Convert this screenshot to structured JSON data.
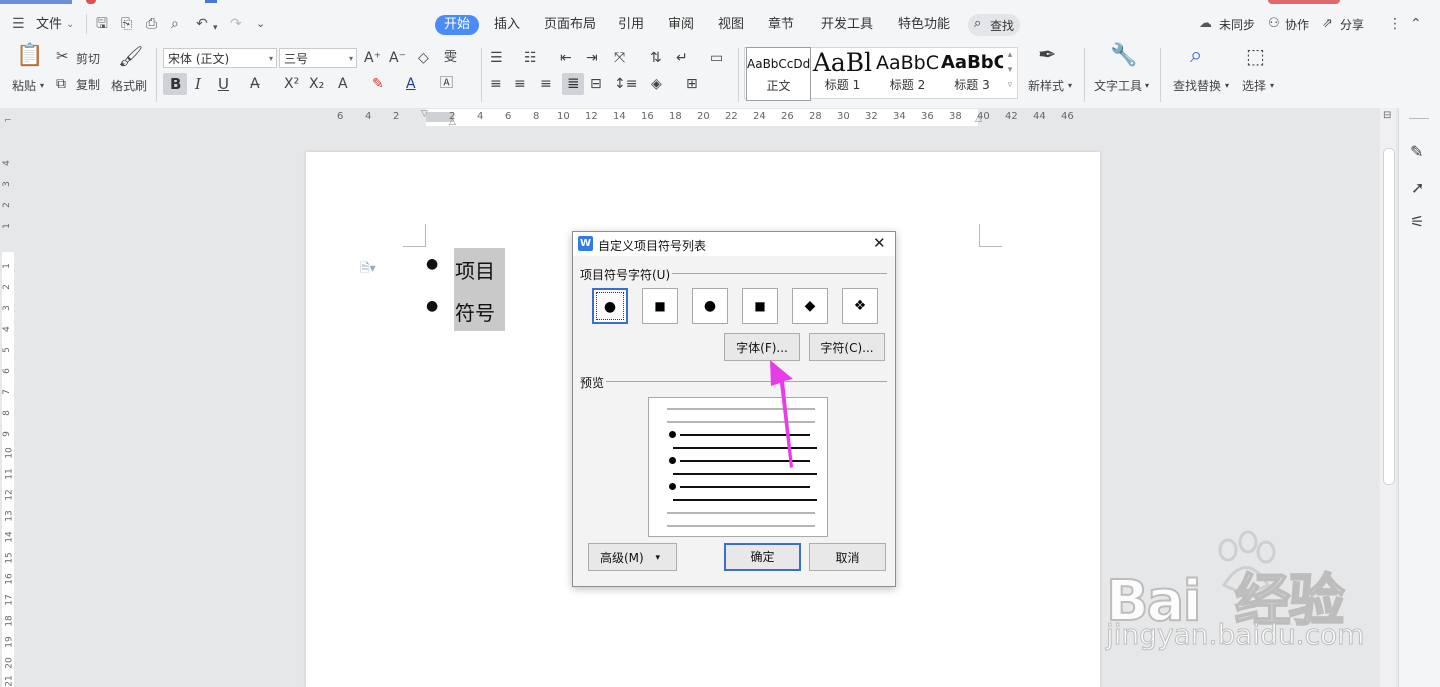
{
  "menubar": {
    "file_label": "文件",
    "tabs": [
      "开始",
      "插入",
      "页面布局",
      "引用",
      "审阅",
      "视图",
      "章节",
      "开发工具",
      "特色功能"
    ],
    "active_tab": "开始",
    "search_label": "查找",
    "sync_label": "未同步",
    "collab_label": "协作",
    "share_label": "分享"
  },
  "ribbon": {
    "paste": "粘贴",
    "cut": "剪切",
    "copy": "复制",
    "format_painter": "格式刷",
    "font_name": "宋体 (正文)",
    "font_size": "三号",
    "styles": [
      {
        "sample": "AaBbCcDd",
        "label": "正文"
      },
      {
        "sample": "AaBl",
        "label": "标题 1"
      },
      {
        "sample": "AaBbC",
        "label": "标题 2"
      },
      {
        "sample": "AaBbC",
        "label": "标题 3"
      }
    ],
    "new_style": "新样式",
    "text_tools": "文字工具",
    "find_replace": "查找替换",
    "select": "选择",
    "bold": "B",
    "italic": "I",
    "underline": "U"
  },
  "ruler": {
    "h_ticks": [
      "6",
      "4",
      "2",
      "2",
      "4",
      "6",
      "8",
      "10",
      "12",
      "14",
      "16",
      "18",
      "20",
      "22",
      "24",
      "26",
      "28",
      "30",
      "32",
      "34",
      "36",
      "38",
      "40",
      "42",
      "44",
      "46"
    ],
    "v_ticks_top": [
      "4",
      "3",
      "2",
      "1"
    ],
    "v_ticks": [
      "1",
      "2",
      "3",
      "4",
      "5",
      "6",
      "7",
      "8",
      "9",
      "10",
      "11",
      "12",
      "13",
      "14",
      "15",
      "16",
      "17",
      "18",
      "19",
      "20",
      "21"
    ]
  },
  "document": {
    "items": [
      "项目",
      "符号"
    ]
  },
  "dialog": {
    "title": "自定义项目符号列表",
    "symbols_group": "项目符号字符(U)",
    "symbols": [
      "●",
      "■",
      "●",
      "■",
      "◆",
      "❖"
    ],
    "font_button": "字体(F)...",
    "char_button": "字符(C)...",
    "preview_group": "预览",
    "advanced_button": "高级(M)",
    "ok_button": "确定",
    "cancel_button": "取消"
  },
  "watermark": {
    "brand": "Bai  经验",
    "url": "jingyan.baidu.com"
  },
  "colors": {
    "accent": "#4a8cf7",
    "annotation_arrow": "#e83ce8"
  }
}
